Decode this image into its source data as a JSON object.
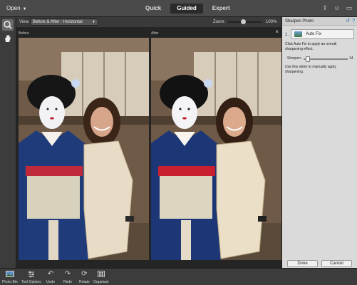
{
  "topbar": {
    "open_label": "Open",
    "modes": [
      {
        "label": "Quick",
        "active": false
      },
      {
        "label": "Guided",
        "active": true
      },
      {
        "label": "Expert",
        "active": false
      }
    ],
    "icons": [
      "share-icon",
      "help-icon",
      "window-icon"
    ]
  },
  "tools": [
    "zoom-tool-icon",
    "hand-tool-icon"
  ],
  "options": {
    "view_label": "View:",
    "view_value": "Before & After - Horizontal",
    "zoom_label": "Zoom:",
    "zoom_value": "100%",
    "zoom_fraction": 0.45
  },
  "canvas": {
    "before_label": "Before",
    "after_label": "After",
    "close_glyph": "×"
  },
  "panel": {
    "title": "Sharpen Photo",
    "step_number": "1.",
    "autofix_label": "Auto Fix",
    "autofix_help": "Click Auto Fix to apply an overall sharpening effect.",
    "sharpen_label": "Sharpen:",
    "sharpen_value": "14",
    "sharpen_fraction": 0.05,
    "slider_help": "Use this slider to manually apply sharpening.",
    "done_label": "Done",
    "cancel_label": "Cancel"
  },
  "bottombar": {
    "items": [
      {
        "label": "Photo Bin",
        "icon": "photo-bin-icon"
      },
      {
        "label": "Tool Options",
        "icon": "tool-options-icon"
      },
      {
        "label": "Undo",
        "icon": "undo-icon"
      },
      {
        "label": "Redo",
        "icon": "redo-icon"
      },
      {
        "label": "Rotate",
        "icon": "rotate-icon"
      },
      {
        "label": "Organizer",
        "icon": "organizer-icon"
      }
    ]
  },
  "colors": {
    "accent": "#2a6fb0",
    "kimono_blue": "#1f3b7a",
    "obi_red": "#c0293a"
  }
}
